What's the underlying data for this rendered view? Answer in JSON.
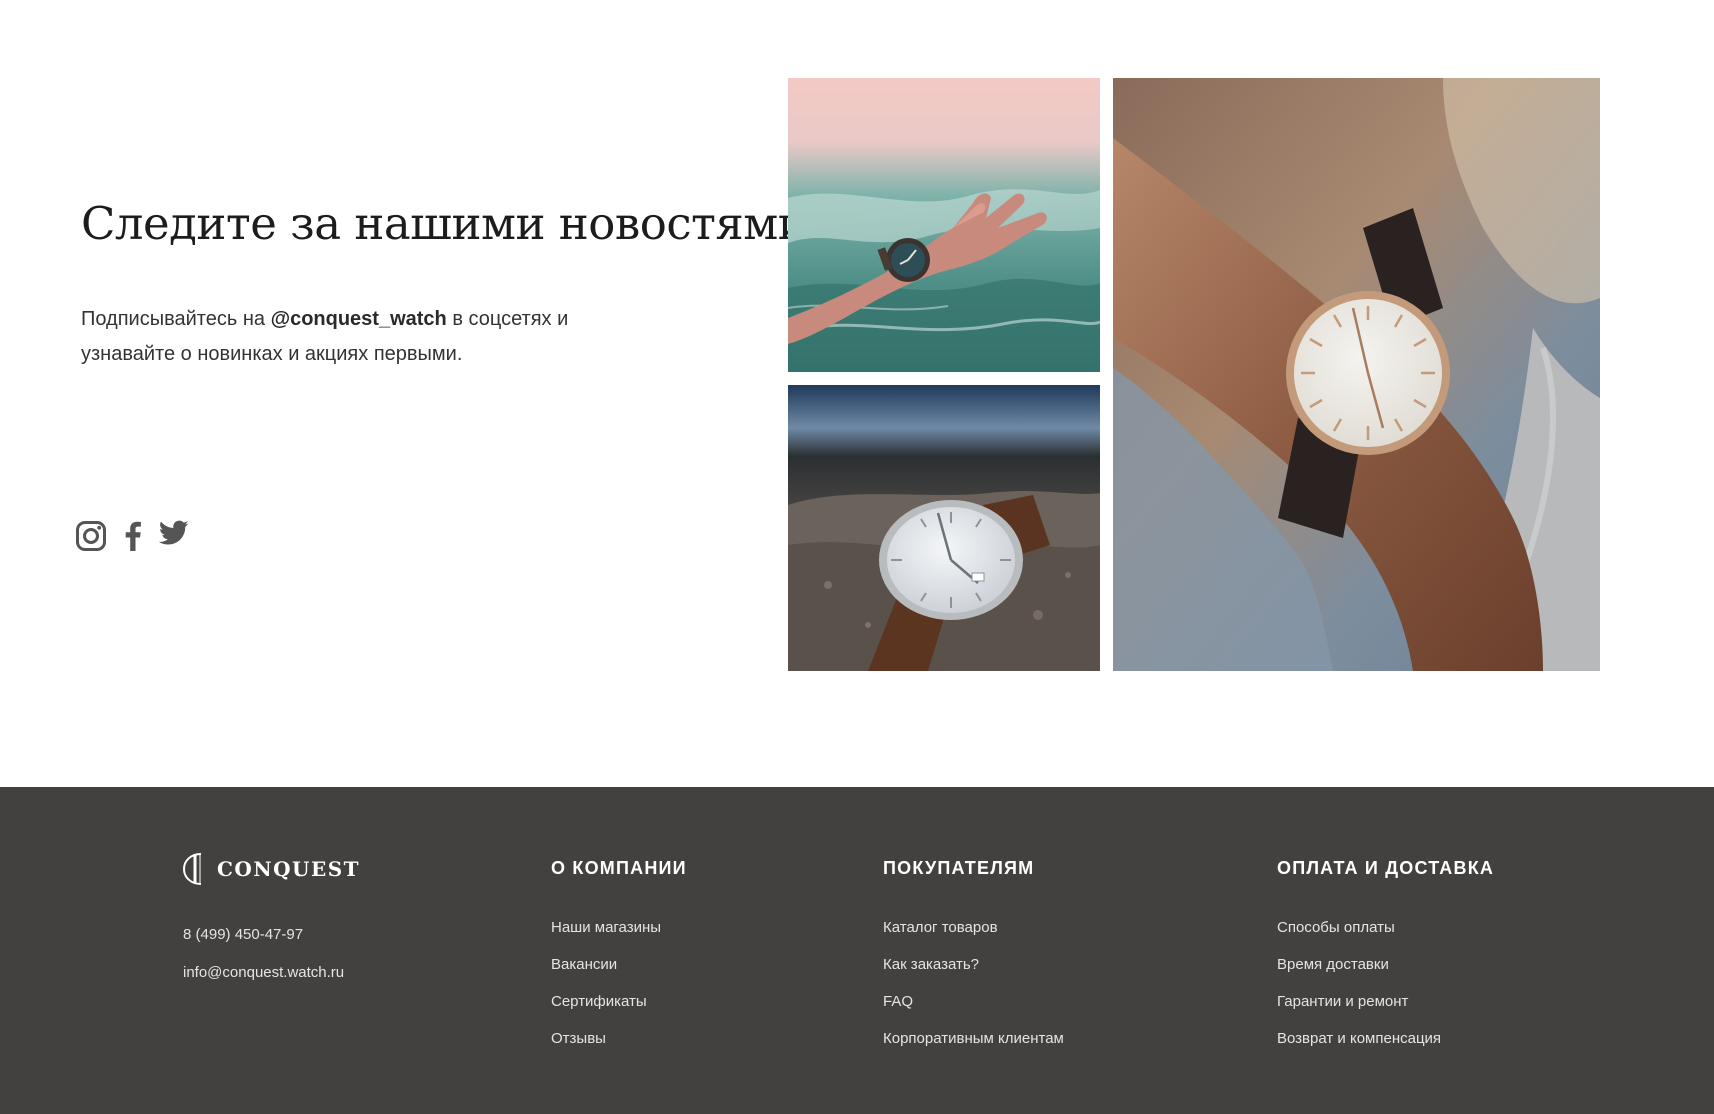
{
  "news": {
    "title": "Следите за нашими новостями",
    "text_before": "Подписывайтесь на ",
    "handle": "@conquest_watch",
    "text_after": " в соцсетях и узнавайте о новинках и акциях первыми.",
    "social": [
      {
        "name": "instagram",
        "icon": "instagram-icon"
      },
      {
        "name": "facebook",
        "icon": "facebook-icon"
      },
      {
        "name": "twitter",
        "icon": "twitter-icon"
      }
    ],
    "photos": [
      "hand-in-sea-watch",
      "watch-on-rock",
      "watch-on-wrist"
    ]
  },
  "footer": {
    "logo_text": "CONQUEST",
    "phone": "8 (499) 450-47-97",
    "email": "info@conquest.watch.ru",
    "columns": [
      {
        "title": "О КОМПАНИИ",
        "links": [
          "Наши магазины",
          "Вакансии",
          "Сертификаты",
          "Отзывы"
        ]
      },
      {
        "title": "ПОКУПАТЕЛЯМ",
        "links": [
          "Каталог товаров",
          "Как заказать?",
          "FAQ",
          "Корпоративным клиентам"
        ]
      },
      {
        "title": "ОПЛАТА И ДОСТАВКА",
        "links": [
          "Способы оплаты",
          "Время доставки",
          "Гарантии и ремонт",
          "Возврат и компенсация"
        ]
      }
    ]
  },
  "colors": {
    "footer_bg": "#424140",
    "icon": "#555555",
    "text": "#333333"
  }
}
